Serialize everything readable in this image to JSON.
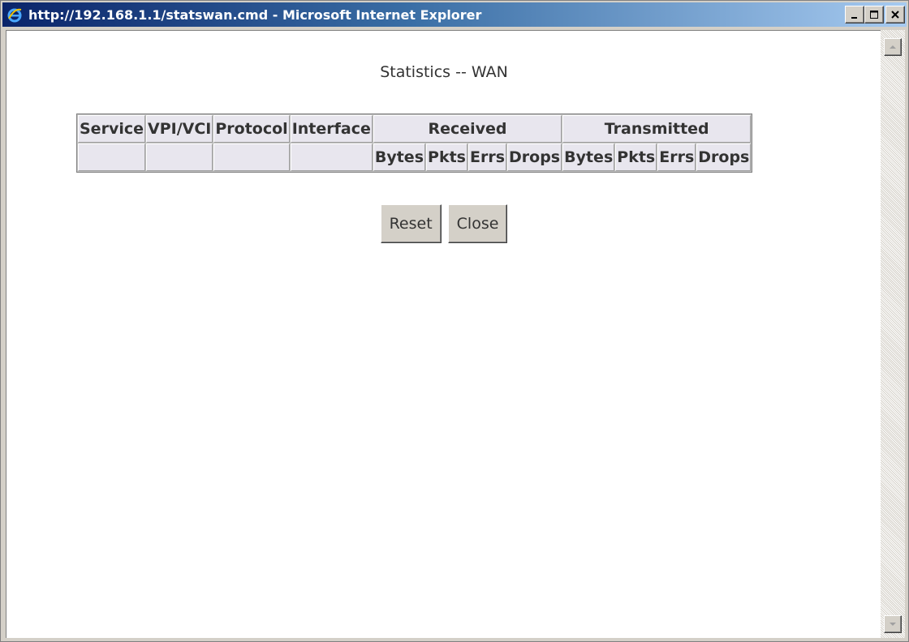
{
  "window": {
    "title": "http://192.168.1.1/statswan.cmd - Microsoft Internet Explorer",
    "icon": "internet-explorer-icon",
    "controls": [
      "minimize-icon",
      "maximize-icon",
      "close-icon"
    ]
  },
  "page": {
    "title": "Statistics -- WAN"
  },
  "table": {
    "headers": {
      "service": "Service",
      "vpi_vci": "VPI/VCI",
      "protocol": "Protocol",
      "interface": "Interface",
      "received": "Received",
      "transmitted": "Transmitted"
    },
    "received_subheaders": [
      "Bytes",
      "Pkts",
      "Errs",
      "Drops"
    ],
    "transmitted_subheaders": [
      "Bytes",
      "Pkts",
      "Errs",
      "Drops"
    ]
  },
  "buttons": {
    "reset": "Reset",
    "close": "Close"
  },
  "colors": {
    "titlebar_start": "#0a246a",
    "titlebar_end": "#a6caf0",
    "table_cell": "#e8e6ee",
    "button_face": "#d4d0c8"
  }
}
